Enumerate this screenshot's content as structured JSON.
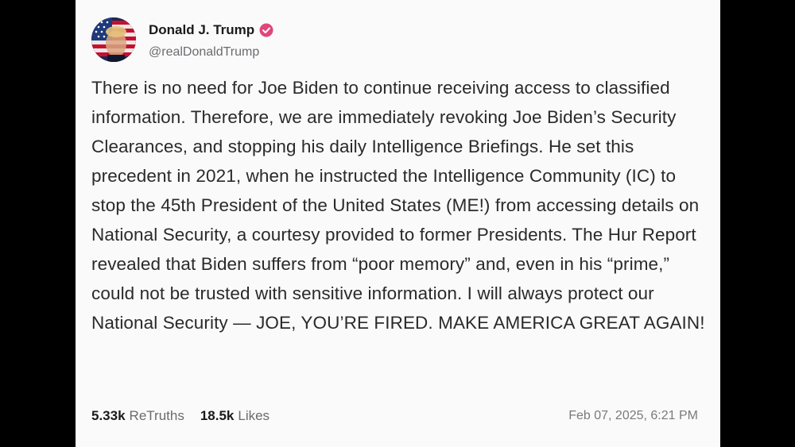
{
  "post": {
    "author": {
      "display_name": "Donald J. Trump",
      "handle": "@realDonaldTrump",
      "verified_badge_icon": "verified-check-icon",
      "badge_color": "#e0457b"
    },
    "text": "There is no need for Joe Biden to continue receiving access to classified information. Therefore, we are immediately revoking Joe Biden’s Security Clearances, and stopping his daily Intelligence Briefings. He set this precedent in 2021, when he instructed the Intelligence Community (IC) to stop the 45th President of the United States (ME!) from accessing details on National Security, a courtesy provided to former Presidents. The Hur Report revealed that Biden suffers from “poor memory” and, even in his “prime,” could not be trusted with sensitive information. I will always protect our National Security — JOE, YOU’RE FIRED. MAKE AMERICA GREAT AGAIN!",
    "stats": {
      "retruths_count": "5.33k",
      "retruths_label": "ReTruths",
      "likes_count": "18.5k",
      "likes_label": "Likes"
    },
    "timestamp": "Feb 07, 2025, 6:21 PM"
  }
}
